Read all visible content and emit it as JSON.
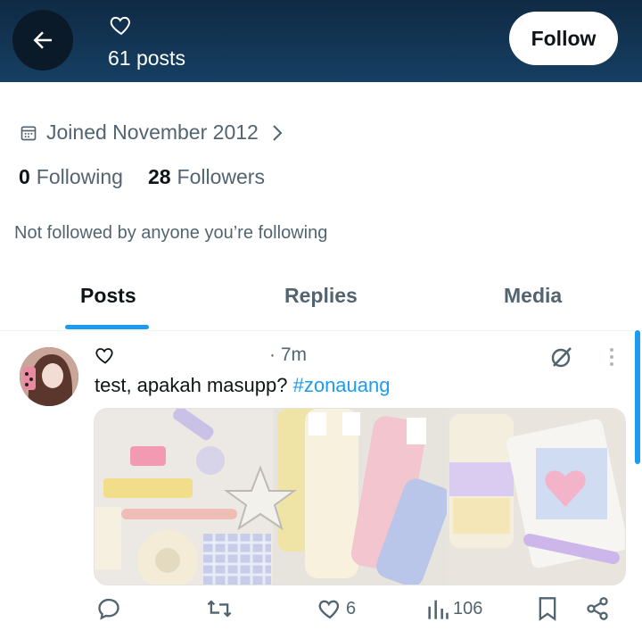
{
  "header": {
    "posts_count": "61 posts",
    "follow_label": "Follow"
  },
  "profile": {
    "joined": "Joined November 2012",
    "following_count": "0",
    "following_label": "Following",
    "followers_count": "28",
    "followers_label": "Followers",
    "not_followed": "Not followed by anyone you’re following"
  },
  "tabs": [
    {
      "label": "Posts",
      "active": true
    },
    {
      "label": "Replies",
      "active": false
    },
    {
      "label": "Media",
      "active": false
    }
  ],
  "tweet": {
    "time": "· 7m",
    "text": "test, apakah masupp? ",
    "hashtag": "#zonauang",
    "likes": "6",
    "views": "106"
  },
  "colors": {
    "header_bg": "#163f63",
    "accent": "#1d9bf0",
    "muted": "#536471"
  },
  "icons": [
    "back-arrow-icon",
    "heart-icon",
    "calendar-icon",
    "chevron-right-icon",
    "grok-icon",
    "more-icon",
    "reply-icon",
    "retweet-icon",
    "like-icon",
    "views-icon",
    "bookmark-icon",
    "share-icon"
  ]
}
